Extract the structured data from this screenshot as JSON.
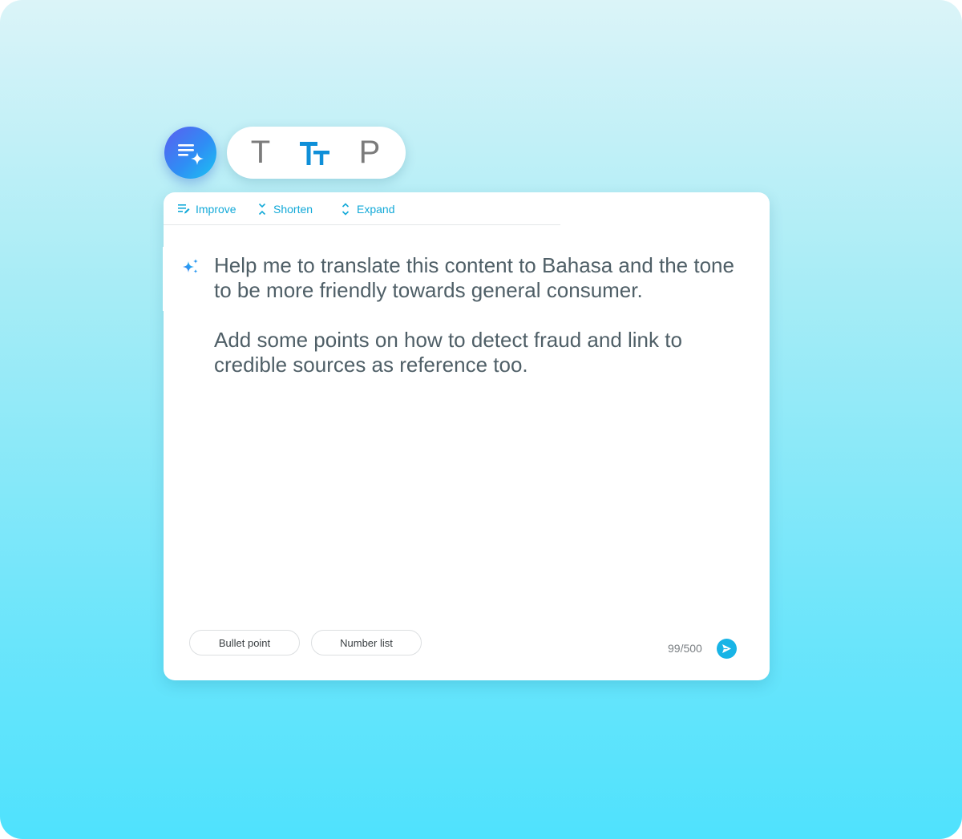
{
  "colors": {
    "accent": "#12a9d8",
    "active_format": "#0f8fd8",
    "text": "#4f5f67"
  },
  "ai_button": {
    "icon": "ai-write-sparkle-icon"
  },
  "format_options": [
    {
      "label": "T",
      "icon": "text-icon",
      "active": false
    },
    {
      "label": "Tt",
      "icon": "text-size-icon",
      "active": true
    },
    {
      "label": "P",
      "icon": "paragraph-icon",
      "active": false
    }
  ],
  "toolbar": {
    "improve_label": "Improve",
    "shorten_label": "Shorten",
    "expand_label": "Expand"
  },
  "prompt": {
    "text": "Help me to translate this content to Bahasa and the tone to be more friendly towards general consumer.\n\nAdd some points on how to detect fraud and link to credible sources as reference too."
  },
  "chips": {
    "bullet_point": "Bullet point",
    "number_list": "Number list"
  },
  "counter": "99/500"
}
